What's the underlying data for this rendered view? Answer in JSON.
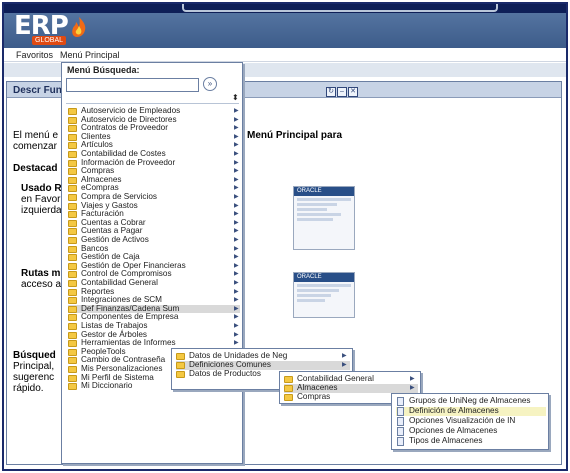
{
  "logo": {
    "text": "ERP",
    "sub": "GLOBAL"
  },
  "menubar": {
    "favorites": "Favoritos",
    "main_menu": "Menú Principal"
  },
  "panel": {
    "title": "Descr Fun",
    "line1a": "El menú e",
    "line1b": "comenzar",
    "line1c": "Menú Principal para",
    "destacad": "Destacad",
    "usado1": "Usado R",
    "usado2": "en Favori",
    "usado3": "izquierda",
    "rutas1": "Rutas m",
    "rutas2": "acceso al",
    "busq1": "Búsqued",
    "busq2": "Principal,",
    "busq3": "sugerenc",
    "busq4": "rápido.",
    "thumb_brand": "ORACLE"
  },
  "menu": {
    "title": "Menú Búsqueda:",
    "search_value": "",
    "go_glyph": "»",
    "sort_glyph": "⬍",
    "items": [
      "Autoservicio de Empleados",
      "Autoservicio de Directores",
      "Contratos de Proveedor",
      "Clientes",
      "Artículos",
      "Contabilidad de Costes",
      "Información de Proveedor",
      "Compras",
      "Almacenes",
      "eCompras",
      "Compra de Servicios",
      "Viajes y Gastos",
      "Facturación",
      "Cuentas a Cobrar",
      "Cuentas a Pagar",
      "Gestión de Activos",
      "Bancos",
      "Gestión de Caja",
      "Gestión de Oper Financieras",
      "Control de Compromisos",
      "Contabilidad General",
      "Reportes",
      "Integraciones de SCM",
      "Def Finanzas/Cadena Sum",
      "Componentes de Empresa",
      "Listas de Trabajos",
      "Gestor de Árboles",
      "Herramientas de Informes",
      "PeopleTools",
      "Cambio de Contraseña",
      "Mis Personalizaciones",
      "Mi Perfil de Sistema",
      "Mi Diccionario"
    ]
  },
  "submenu1": {
    "items": [
      "Datos de Unidades de Neg",
      "Definiciones Comunes",
      "Datos de Productos"
    ]
  },
  "submenu2": {
    "items": [
      "Contabilidad General",
      "Almacenes",
      "Compras"
    ]
  },
  "submenu3": {
    "items": [
      "Grupos de UniNeg de Almacenes",
      "Definición de Almacenes",
      "Opciones Visualización de IN",
      "Opciones de Almacenes",
      "Tipos de Almacenes"
    ]
  }
}
